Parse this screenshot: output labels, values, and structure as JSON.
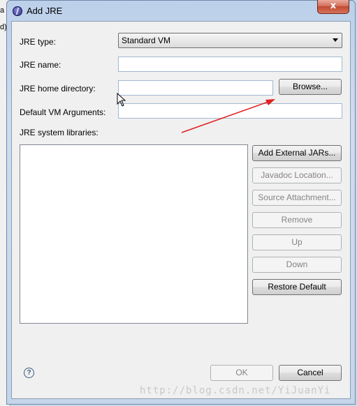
{
  "background": {
    "left_fragments": [
      "a",
      "d)"
    ]
  },
  "window": {
    "title": "Add JRE",
    "close_symbol": "x"
  },
  "form": {
    "jre_type_label": "JRE type:",
    "jre_type_value": "Standard VM",
    "jre_name_label": "JRE name:",
    "jre_name_value": "",
    "home_dir_label": "JRE home directory:",
    "home_dir_value": "",
    "browse_label": "Browse...",
    "vm_args_label": "Default VM Arguments:",
    "vm_args_value": "",
    "libs_label": "JRE system libraries:"
  },
  "lib_buttons": {
    "add_external": "Add External JARs...",
    "javadoc": "Javadoc Location...",
    "source": "Source Attachment...",
    "remove": "Remove",
    "up": "Up",
    "down": "Down",
    "restore": "Restore Default"
  },
  "footer": {
    "help_symbol": "?",
    "ok_label": "OK",
    "cancel_label": "Cancel"
  },
  "watermark": "http://blog.csdn.net/YiJuanYi",
  "colors": {
    "annotation_arrow": "#e02020"
  },
  "icons": [
    "eclipse-app-icon",
    "close-icon",
    "combo-arrow-icon",
    "help-icon",
    "mouse-cursor-icon"
  ]
}
